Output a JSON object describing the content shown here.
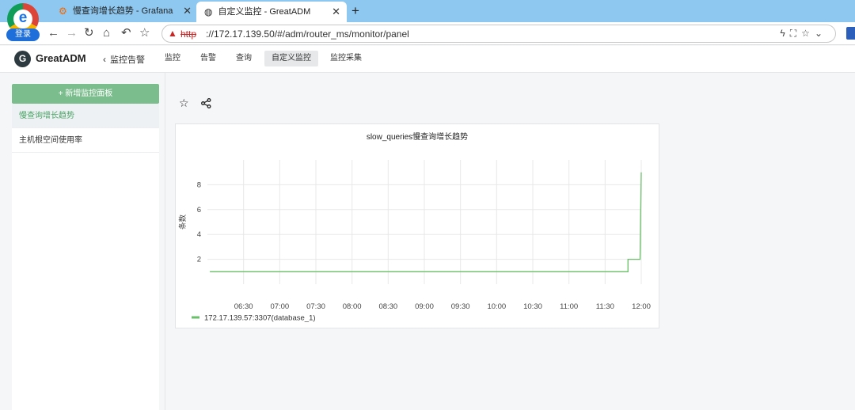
{
  "browser": {
    "login_label": "登录",
    "tabs": [
      {
        "label": "慢查询增长趋势 - Grafana",
        "icon": "grafana-icon",
        "active": false
      },
      {
        "label": "自定义监控 - GreatADM",
        "icon": "globe-icon",
        "active": true
      }
    ],
    "new_tab_icon": "plus-icon",
    "address": {
      "warning_icon": "warning-triangle-icon",
      "scheme": "http",
      "rest": "://172.17.139.50/#/adm/router_ms/monitor/panel"
    }
  },
  "app": {
    "name": "GreatADM",
    "back_label": "监控告警",
    "nav": [
      {
        "label": "监控",
        "active": false
      },
      {
        "label": "告警",
        "active": false
      },
      {
        "label": "查询",
        "active": false
      },
      {
        "label": "自定义监控",
        "active": true
      },
      {
        "label": "监控采集",
        "active": false
      }
    ]
  },
  "sidebar": {
    "add_button": "+ 新增监控面板",
    "items": [
      {
        "label": "慢查询增长趋势",
        "active": true
      },
      {
        "label": "主机根空间使用率",
        "active": false
      }
    ]
  },
  "panel": {
    "title": "slow_queries慢查询增长趋势"
  },
  "colors": {
    "accent_green": "#4aa365",
    "series_green": "#6abf69",
    "add_button_bg": "#7cbd8e"
  },
  "chart_data": {
    "type": "line",
    "title": "slow_queries慢查询增长趋势",
    "ylabel": "条数",
    "xlabel": "",
    "x_ticks": [
      "06:30",
      "07:00",
      "07:30",
      "08:00",
      "08:30",
      "09:00",
      "09:30",
      "10:00",
      "10:30",
      "11:00",
      "11:30",
      "12:00"
    ],
    "y_ticks": [
      2,
      4,
      6,
      8
    ],
    "xlim": [
      "06:00",
      "12:00"
    ],
    "ylim": [
      0,
      10
    ],
    "grid": true,
    "legend_position": "bottom-left",
    "series": [
      {
        "name": "172.17.139.57:3307(database_1)",
        "color": "#6abf69",
        "points": [
          [
            "06:02",
            1
          ],
          [
            "11:49",
            1
          ],
          [
            "11:49",
            2
          ],
          [
            "11:59",
            2
          ],
          [
            "12:00",
            9
          ]
        ]
      }
    ]
  }
}
